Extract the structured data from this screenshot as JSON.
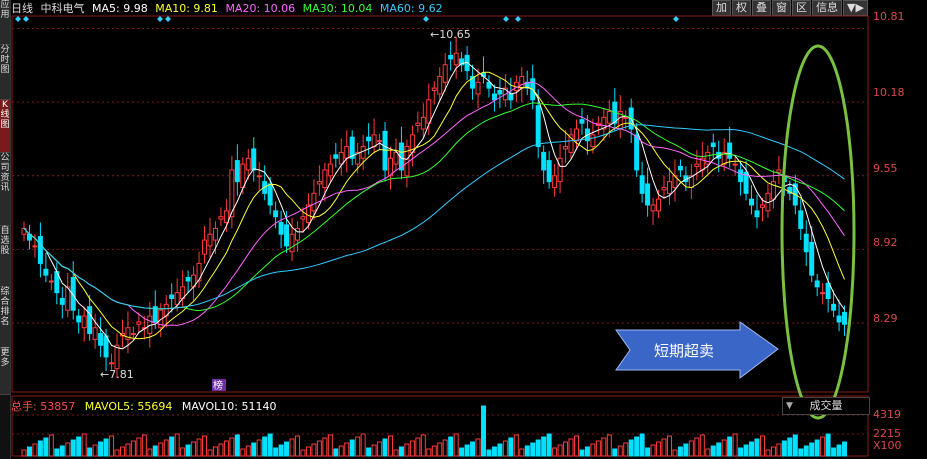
{
  "side_tabs": [
    {
      "label": "应用",
      "active": false
    },
    {
      "label": "分时图",
      "active": false
    },
    {
      "label": "K线图",
      "active": true
    },
    {
      "label": "公司资讯",
      "active": false
    },
    {
      "label": "自选股",
      "active": false
    },
    {
      "label": "综合排名",
      "active": false
    },
    {
      "label": "更多",
      "active": false
    }
  ],
  "header": {
    "period": "日线",
    "stock_name": "中科电气",
    "ma5": "MA5: 9.98",
    "ma10": "MA10: 9.81",
    "ma20": "MA20: 10.06",
    "ma30": "MA30: 10.04",
    "ma60": "MA60: 9.62"
  },
  "toolbar": {
    "buttons": [
      "加",
      "权",
      "叠",
      "窗",
      "区",
      "信息"
    ],
    "menu_icon": "▼▶"
  },
  "price_axis": [
    "10.81",
    "10.18",
    "9.55",
    "8.92",
    "8.29"
  ],
  "volume_header": {
    "total": "总手: 53857",
    "mavol5": "MAVOL5: 55694",
    "mavol10": "MAVOL10: 51140"
  },
  "volume_axis": [
    "4319",
    "2215",
    "X100"
  ],
  "volume_button": "成交量",
  "annotations": {
    "high_label": "10.65",
    "low_label": "7.81",
    "rank_tag": "榜",
    "callout": "短期超卖"
  },
  "colors": {
    "up": "#ff3b3b",
    "down": "#00e0ff",
    "ma5": "#ffffff",
    "ma10": "#ffff33",
    "ma20": "#ff66ff",
    "ma30": "#33ff33",
    "ma60": "#33ccff",
    "arrow_fill": "#3a66c8",
    "ellipse": "#7ac142"
  },
  "chart_data": {
    "type": "candlestick",
    "title": "中科电气 日线",
    "ylim": [
      7.7,
      10.9
    ],
    "high": 10.65,
    "low": 7.81,
    "last_close_approx": 8.29
  }
}
